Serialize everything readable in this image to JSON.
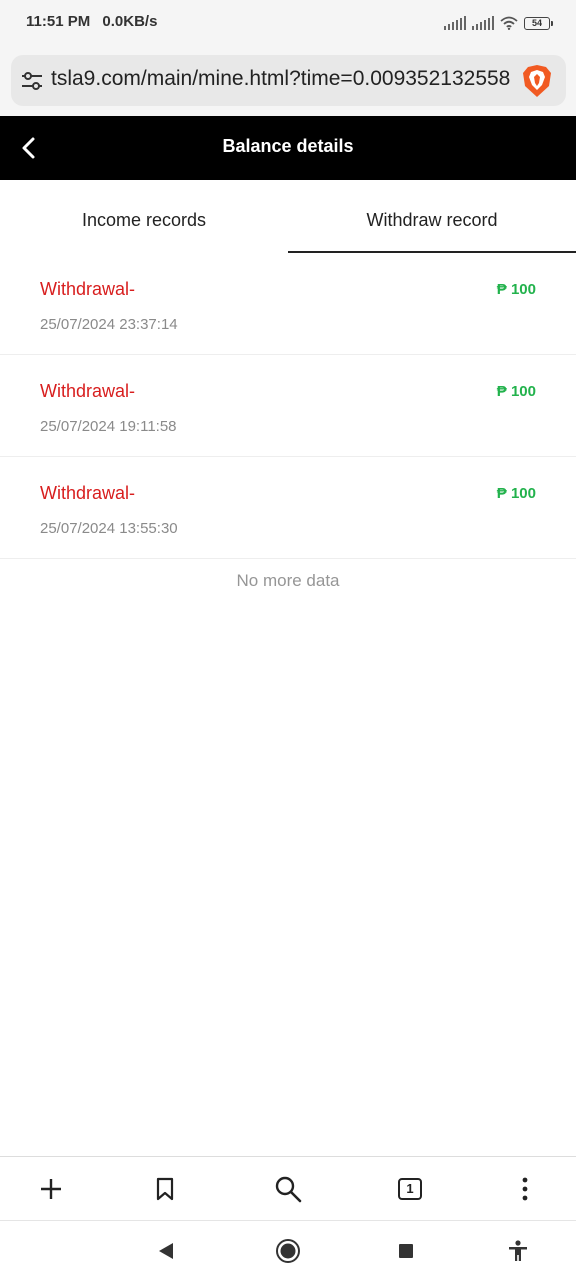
{
  "status_bar": {
    "time": "11:51 PM",
    "speed": "0.0KB/s",
    "battery": "54"
  },
  "browser": {
    "url": "tsla9.com/main/mine.html?time=0.009352132558",
    "tab_count": "1"
  },
  "header": {
    "title": "Balance details"
  },
  "tabs": [
    {
      "label": "Income records",
      "active": false
    },
    {
      "label": "Withdraw record",
      "active": true
    }
  ],
  "records": [
    {
      "type": "Withdrawal-",
      "amount": "₱ 100",
      "time": "25/07/2024 23:37:14"
    },
    {
      "type": "Withdrawal-",
      "amount": "₱ 100",
      "time": "25/07/2024 19:11:58"
    },
    {
      "type": "Withdrawal-",
      "amount": "₱ 100",
      "time": "25/07/2024 13:55:30"
    }
  ],
  "footer_text": "No more data",
  "colors": {
    "header_bg": "#000000",
    "withdrawal_text": "#d81e1e",
    "amount_text": "#22b24c",
    "muted_text": "#8a8a8a"
  },
  "icons": {
    "browser": [
      "tune-icon",
      "brave-lion-icon"
    ],
    "header": [
      "chevron-left-icon"
    ],
    "toolbar": [
      "plus-icon",
      "bookmark-icon",
      "search-icon",
      "tabs-icon",
      "more-vertical-icon"
    ],
    "nav": [
      "back-triangle-icon",
      "home-circle-icon",
      "recents-square-icon",
      "accessibility-icon"
    ]
  }
}
